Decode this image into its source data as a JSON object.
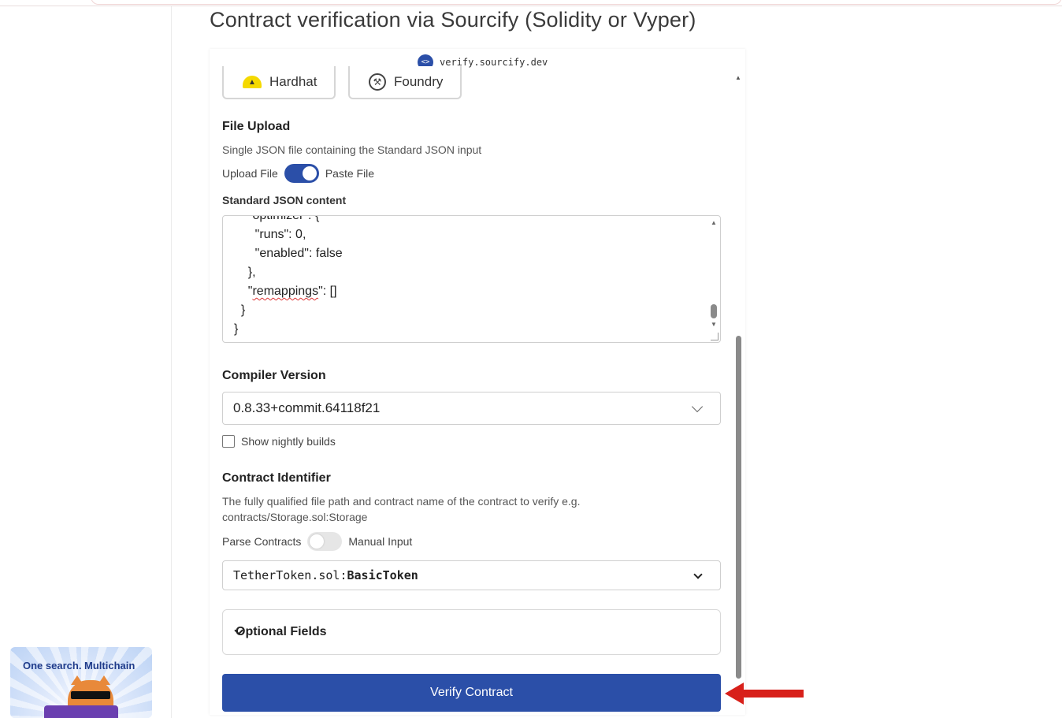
{
  "page_title": "Contract verification via Sourcify (Solidity or Vyper)",
  "badge": {
    "icon": "sourcify-icon",
    "text": "verify.sourcify.dev"
  },
  "frameworks": [
    {
      "label": "Hardhat",
      "icon": "hardhat-icon"
    },
    {
      "label": "Foundry",
      "icon": "foundry-icon"
    }
  ],
  "file_upload": {
    "title": "File Upload",
    "description": "Single JSON file containing the Standard JSON input",
    "toggle_left": "Upload File",
    "toggle_right": "Paste File",
    "toggle_on": true,
    "content_label": "Standard JSON content",
    "json_lines": [
      "    \"optimizer\": {",
      "      \"runs\": 0,",
      "      \"enabled\": false",
      "    },",
      "    \"remappings\": []",
      "  }",
      "}"
    ]
  },
  "compiler": {
    "title": "Compiler Version",
    "selected": "0.8.33+commit.64118f21",
    "nightly_label": "Show nightly builds",
    "nightly_checked": false
  },
  "contract_identifier": {
    "title": "Contract Identifier",
    "description_line1": "The fully qualified file path and contract name of the contract to verify e.g.",
    "description_line2": "contracts/Storage.sol:Storage",
    "toggle_left": "Parse Contracts",
    "toggle_right": "Manual Input",
    "toggle_on": false,
    "selected_file": "TetherToken.sol:",
    "selected_contract": "BasicToken"
  },
  "optional_fields": {
    "label": "Optional Fields"
  },
  "verify_button": {
    "label": "Verify Contract",
    "color": "#2b4fa8"
  },
  "annotation_arrow": {
    "color": "#d8201a"
  },
  "ad": {
    "text": "One search. Multichain"
  }
}
